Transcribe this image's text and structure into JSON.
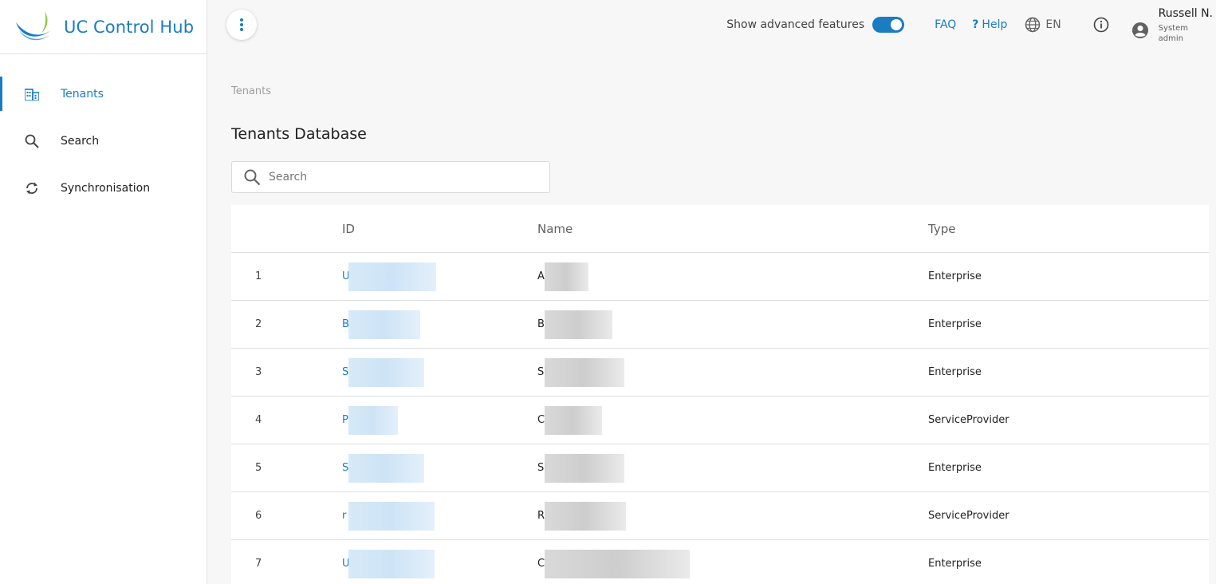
{
  "app": {
    "title": "UC Control Hub"
  },
  "colors": {
    "accent": "#1a7cc1",
    "logo_blue": "#1a7cc1",
    "logo_green": "#8dc63f"
  },
  "sidebar": {
    "items": [
      {
        "label": "Tenants",
        "icon": "building-icon",
        "active": true
      },
      {
        "label": "Search",
        "icon": "search-icon",
        "active": false
      },
      {
        "label": "Synchronisation",
        "icon": "sync-icon",
        "active": false
      }
    ]
  },
  "topbar": {
    "advanced_label": "Show advanced features",
    "advanced_enabled": true,
    "faq": "FAQ",
    "help_mark": "?",
    "help": "Help",
    "language": "EN",
    "user_name": "Russell N.",
    "user_role": "System admin"
  },
  "breadcrumb": "Tenants",
  "page_title": "Tenants Database",
  "search": {
    "placeholder": "Search",
    "value": ""
  },
  "table": {
    "columns": [
      "",
      "ID",
      "Name",
      "Type"
    ],
    "rows": [
      {
        "num": "1",
        "id": "U",
        "name": "A",
        "type": "Enterprise"
      },
      {
        "num": "2",
        "id": "B",
        "name": "B",
        "type": "Enterprise"
      },
      {
        "num": "3",
        "id": "S",
        "name": "Sl",
        "type": "Enterprise"
      },
      {
        "num": "4",
        "id": "P",
        "name": "C",
        "type": "ServiceProvider"
      },
      {
        "num": "5",
        "id": "S",
        "name": "Sl",
        "type": "Enterprise"
      },
      {
        "num": "6",
        "id": "r",
        "name": "R",
        "type": "ServiceProvider"
      },
      {
        "num": "7",
        "id": "U",
        "name": "C",
        "type": "Enterprise"
      }
    ]
  }
}
